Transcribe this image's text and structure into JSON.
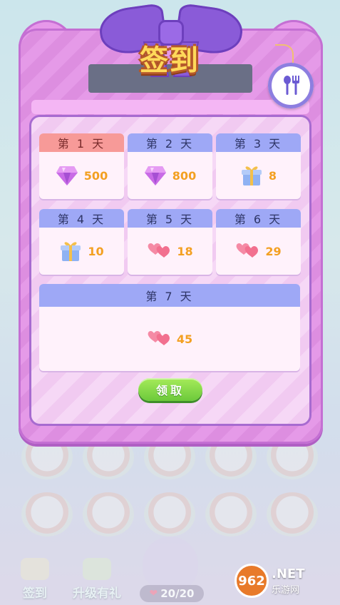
{
  "dialog": {
    "title": "签到",
    "claim_label": "领取",
    "days": [
      {
        "label": "第 1 天",
        "reward": "gem",
        "amount": "500",
        "active": true
      },
      {
        "label": "第 2 天",
        "reward": "gem",
        "amount": "800"
      },
      {
        "label": "第 3 天",
        "reward": "gift",
        "amount": "8"
      },
      {
        "label": "第 4 天",
        "reward": "gift",
        "amount": "10"
      },
      {
        "label": "第 5 天",
        "reward": "hearts",
        "amount": "18"
      },
      {
        "label": "第 6 天",
        "reward": "hearts",
        "amount": "29"
      },
      {
        "label": "第 7 天",
        "reward": "hearts",
        "amount": "45"
      }
    ]
  },
  "background": {
    "bottom_buttons": [
      {
        "label": "签到"
      },
      {
        "label": "升级有礼"
      }
    ],
    "counter": "20/20"
  },
  "watermark": {
    "badge": "962",
    "text": ".NET",
    "sub": "乐游网"
  },
  "colors": {
    "panel": "#e59ae8",
    "day_header": "#9ea8f6",
    "active_header": "#f79a98",
    "amount": "#f3a022",
    "claim_button": "#6cc93b"
  }
}
